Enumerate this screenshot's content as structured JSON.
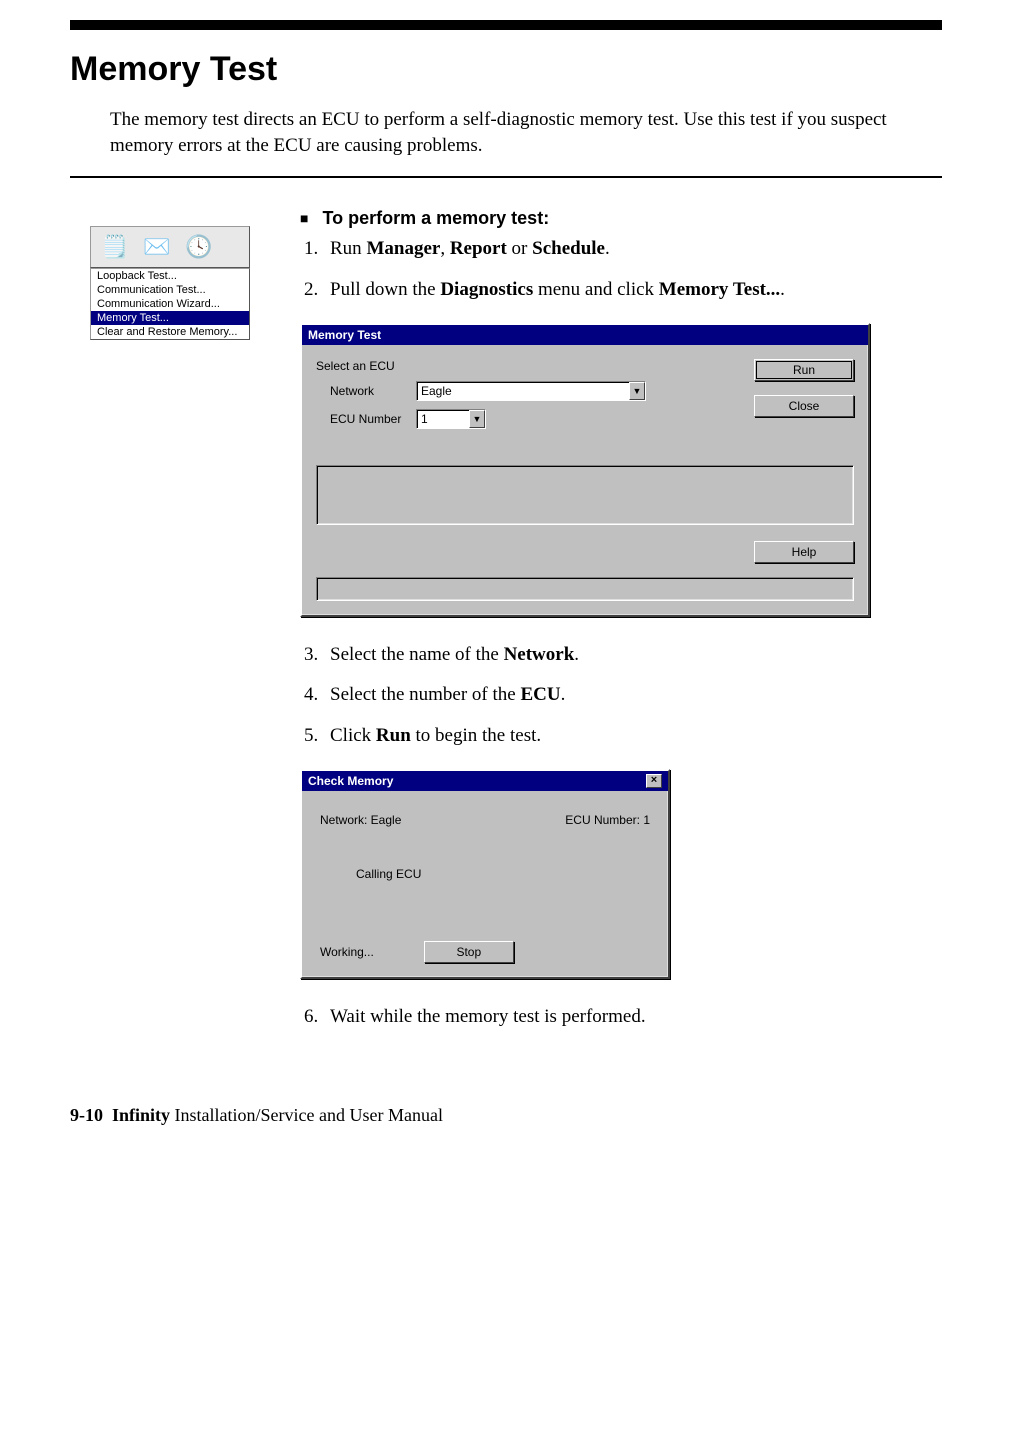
{
  "heading": "Memory Test",
  "intro": "The memory test directs an ECU to perform a self-diagnostic memory test. Use this test if you suspect memory errors at the ECU are causing problems.",
  "task_heading": "To perform a memory test:",
  "steps": {
    "s1": {
      "num": "1.",
      "pre": "Run ",
      "b1": "Manager",
      "mid1": ", ",
      "b2": "Report",
      "mid2": " or ",
      "b3": "Schedule",
      "post": "."
    },
    "s2": {
      "num": "2.",
      "pre": "Pull down the ",
      "b1": "Diagnostics",
      "mid1": " menu and click ",
      "b2": "Memory Test...",
      "post": "."
    },
    "s3": {
      "num": "3.",
      "pre": "Select the name of the ",
      "b1": "Network",
      "post": "."
    },
    "s4": {
      "num": "4.",
      "pre": "Select the number of the ",
      "b1": "ECU",
      "post": "."
    },
    "s5": {
      "num": "5.",
      "pre": "Click ",
      "b1": "Run",
      "post": " to begin the test."
    },
    "s6": {
      "num": "6.",
      "txt": "Wait while the memory test is performed."
    }
  },
  "mini_menu": {
    "items": [
      "Loopback Test...",
      "Communication Test...",
      "Communication Wizard...",
      "Memory Test...",
      "Clear and Restore Memory..."
    ],
    "selected_index": 3
  },
  "dlg_memory_test": {
    "title": "Memory Test",
    "group_label": "Select an ECU",
    "network_label": "Network",
    "network_value": "Eagle",
    "ecu_label": "ECU Number",
    "ecu_value": "1",
    "run_btn": "Run",
    "close_btn": "Close",
    "help_btn": "Help"
  },
  "dlg_check_memory": {
    "title": "Check Memory",
    "network_text": "Network: Eagle",
    "ecu_text": "ECU Number: 1",
    "msg": "Calling ECU",
    "status": "Working...",
    "stop_btn": "Stop"
  },
  "footer": {
    "page": "9-10",
    "product": "Infinity",
    "rest": " Installation/Service and User Manual"
  }
}
